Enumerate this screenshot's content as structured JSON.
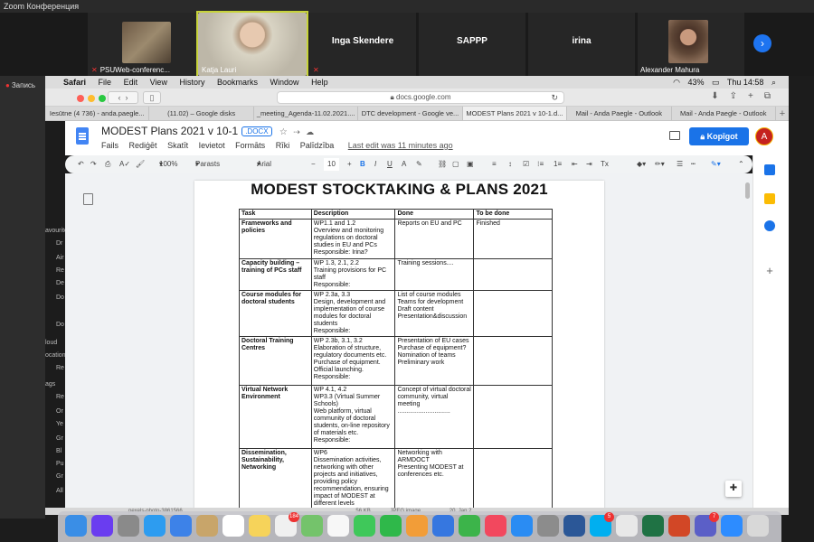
{
  "zoom": {
    "window_title": "Zoom Конференция",
    "recording_label": "Запись",
    "participants": [
      {
        "name": "PSUWeb-conferenc...",
        "muted": true
      },
      {
        "name": "Katja Lauri",
        "muted": false
      },
      {
        "name": "Inga Skendere",
        "muted": false
      },
      {
        "name": "SAPPP",
        "muted": false
      },
      {
        "name": "irina",
        "muted": false
      },
      {
        "name": "Alexander Mahura",
        "muted": false
      }
    ],
    "side_labels": [
      "avourite",
      "Dr",
      "Air",
      "Re",
      "De",
      "Do",
      "Do",
      "loud",
      "ocations",
      "Re",
      "ags",
      "Re",
      "Or",
      "Ye",
      "Gr",
      "Bl",
      "Pu",
      "Gr",
      "All"
    ]
  },
  "menubar": {
    "items": [
      "Safari",
      "File",
      "Edit",
      "View",
      "History",
      "Bookmarks",
      "Window",
      "Help"
    ],
    "battery": "43%",
    "clock": "Thu 14:58"
  },
  "safari": {
    "url": "docs.google.com",
    "tabs": [
      "Iesūtne (4 736) - anda.paegle...",
      "(11.02) – Google disks",
      "_meeting_Agenda-11.02.2021....",
      "DTC development - Google ve...",
      "MODEST Plans 2021 v 10-1.d...",
      "Mail - Anda Paegle - Outlook",
      "Mail - Anda Paegle - Outlook"
    ]
  },
  "docs": {
    "title": "MODEST Plans 2021 v 10-1",
    "badge": ".DOCX",
    "menus": [
      "Fails",
      "Rediģēt",
      "Skatīt",
      "Ievietot",
      "Formāts",
      "Rīki",
      "Palīdzība"
    ],
    "last_edit": "Last edit was 11 minutes ago",
    "share_label": "Kopīgot",
    "avatar_letter": "A",
    "toolbar": {
      "zoom": "100%",
      "style": "Parasts tek...",
      "font": "Arial Narrow",
      "size": "10"
    },
    "heading": "MODEST STOCKTAKING & PLANS 2021",
    "table": {
      "headers": [
        "Task",
        "Description",
        "Done",
        "To be done"
      ],
      "rows": [
        {
          "task": "Frameworks and policies",
          "desc": "WP1.1 and 1.2\nOverview and monitoring regulations on doctoral studies in EU and PCs\nResponsible: Irina?",
          "done": "Reports on EU and PC",
          "todo": "Finished"
        },
        {
          "task": "Capacity building – training of PCs staff",
          "desc": "WP 1.3, 2.1, 2.2\nTraining provisions for PC staff\nResponsible:",
          "done": "Training sessions....",
          "todo": ""
        },
        {
          "task": "Course modules for doctoral students",
          "desc": "WP 2.3a, 3.3\nDesign, development and implementation of course modules for doctoral students\nResponsible:",
          "done": "List of course modules\nTeams for development\nDraft content\nPresentation&discussion",
          "todo": ""
        },
        {
          "task": "Doctoral Training Centres",
          "desc": "WP 2.3b, 3.1, 3.2\nElaboration of structure, regulatory documents etc.\nPurchase of equipment.\nOfficial launching.\nResponsible:",
          "done": "Presentation of EU cases\nPurchase of equipment?\nNomination of teams\nPreliminary work",
          "todo": ""
        },
        {
          "task": "Virtual Network Environment",
          "desc": "WP 4.1, 4.2\nWP3.3 (Virtual Summer Schools)\nWeb platform, virtual community of doctoral students, on-line repository of materials etc.\nResponsible:",
          "done": "Concept of virtual doctoral community, virtual meeting\n..............................",
          "todo": ""
        },
        {
          "task": "Dissemination, Sustainability, Networking",
          "desc": "WP6\nDissemination activities, networking with other projects and initiatives, providing policy recommendation, ensuring impact of MODEST at different levels\nResponsible: ......?",
          "done": "Networking with ARMDOCT\nPresenting MODEST at conferences etc.",
          "todo": ""
        }
      ]
    }
  },
  "finder_strip": {
    "file": "pexels-photo-3861566",
    "size": "56 KB",
    "kind": "JPEG image",
    "date": "20. Jan 2"
  },
  "dock": {
    "apps": [
      {
        "name": "finder",
        "color": "#3a8ee6",
        "badge": ""
      },
      {
        "name": "siri",
        "color": "#6a3df0",
        "badge": ""
      },
      {
        "name": "launchpad",
        "color": "#8a8a8a",
        "badge": ""
      },
      {
        "name": "safari",
        "color": "#2d9cf0",
        "badge": ""
      },
      {
        "name": "mail",
        "color": "#3d82e8",
        "badge": ""
      },
      {
        "name": "photos-app",
        "color": "#c8a56a",
        "badge": ""
      },
      {
        "name": "calendar",
        "color": "#ffffff",
        "badge": ""
      },
      {
        "name": "notes",
        "color": "#f6d35a",
        "badge": ""
      },
      {
        "name": "reminders",
        "color": "#f0f0f0",
        "badge": "184"
      },
      {
        "name": "maps",
        "color": "#74c36b",
        "badge": ""
      },
      {
        "name": "photos",
        "color": "#f7f7f7",
        "badge": ""
      },
      {
        "name": "messages",
        "color": "#3fc85a",
        "badge": ""
      },
      {
        "name": "facetime",
        "color": "#2fb84a",
        "badge": ""
      },
      {
        "name": "pages",
        "color": "#f29d38",
        "badge": ""
      },
      {
        "name": "keynote",
        "color": "#3677e0",
        "badge": ""
      },
      {
        "name": "numbers",
        "color": "#3cb44a",
        "badge": ""
      },
      {
        "name": "music",
        "color": "#f2485e",
        "badge": ""
      },
      {
        "name": "app-store",
        "color": "#2a8cf3",
        "badge": ""
      },
      {
        "name": "system-preferences",
        "color": "#8c8c8c",
        "badge": ""
      },
      {
        "name": "word",
        "color": "#2b5797",
        "badge": ""
      },
      {
        "name": "skype",
        "color": "#00aff0",
        "badge": "5"
      },
      {
        "name": "chrome-app",
        "color": "#e8e8e8",
        "badge": ""
      },
      {
        "name": "excel",
        "color": "#1f7244",
        "badge": ""
      },
      {
        "name": "powerpoint",
        "color": "#d24726",
        "badge": ""
      },
      {
        "name": "teams",
        "color": "#5b5fc7",
        "badge": "7"
      },
      {
        "name": "zoom",
        "color": "#2d8cff",
        "badge": ""
      },
      {
        "name": "trash",
        "color": "#d8d8d8",
        "badge": ""
      }
    ]
  }
}
